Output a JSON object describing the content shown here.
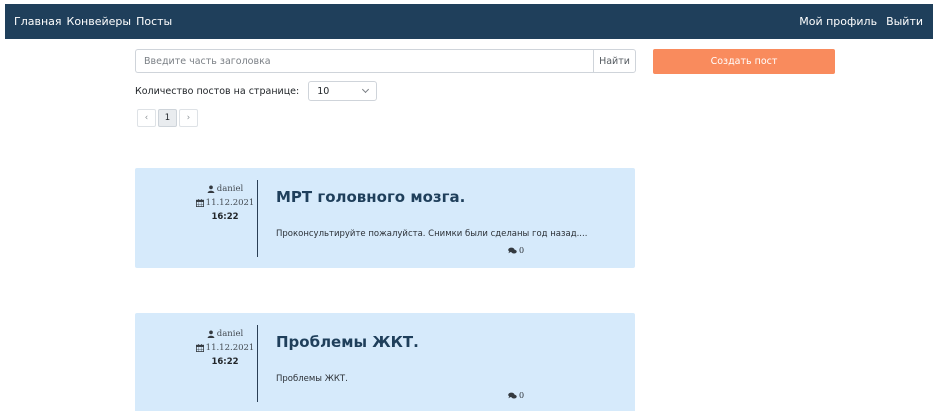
{
  "navbar": {
    "left_links": [
      "Главная",
      "Конвейеры",
      "Посты"
    ],
    "right_links": [
      "Мой профиль",
      "Выйти"
    ],
    "background": "#1f3f5b"
  },
  "search": {
    "placeholder": "Введите часть заголовка",
    "value": "",
    "button_label": "Найти"
  },
  "create_button": {
    "label": "Создать пост",
    "color": "#f98b5d"
  },
  "per_page": {
    "label": "Количество постов на странице:",
    "selected": "10"
  },
  "pagination": {
    "prev": "‹",
    "current": "1",
    "next": "›"
  },
  "posts": [
    {
      "author": "daniel",
      "date": "11.12.2021",
      "time": "16:22",
      "title": "МРТ головного мозга.",
      "excerpt": "Проконсультируйте пожалуйста. Снимки были сделаны год назад....",
      "comments": "0"
    },
    {
      "author": "daniel",
      "date": "11.12.2021",
      "time": "16:22",
      "title": "Проблемы ЖКТ.",
      "excerpt": "Проблемы ЖКТ.",
      "comments": "0"
    }
  ],
  "icons": {
    "author": "user-icon",
    "date": "calendar-icon",
    "comments": "comment-icon"
  },
  "colors": {
    "card_background": "#d6eafb",
    "title": "#1f3f5b"
  }
}
